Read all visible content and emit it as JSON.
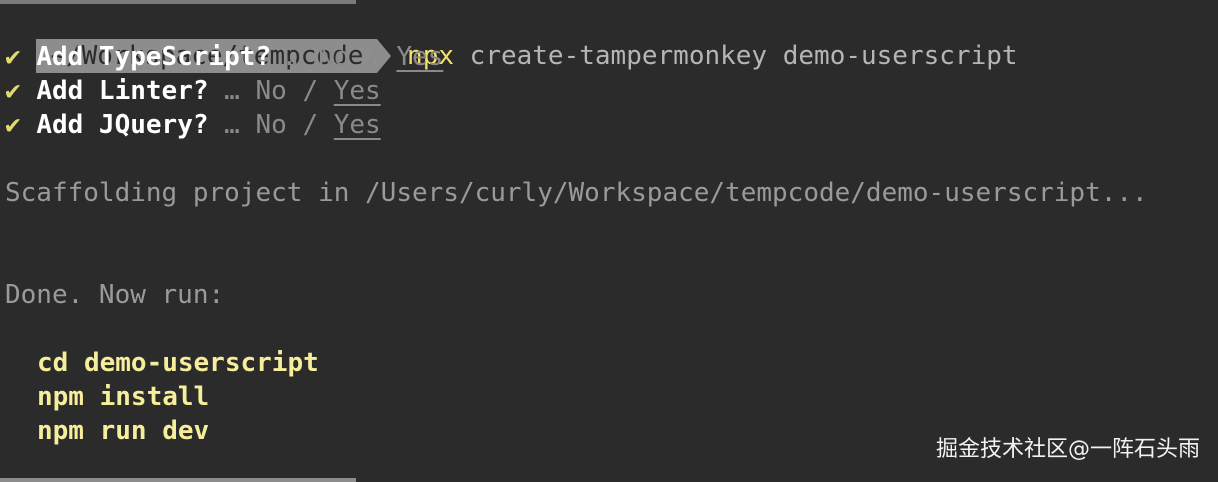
{
  "prompt": {
    "path": "~/Workspace/tempcode",
    "command": "npx",
    "args": " create-tampermonkey demo-userscript"
  },
  "questions": [
    {
      "check": "✔",
      "label": "Add TypeScript?",
      "ellipsis": "…",
      "no": "No",
      "slash": "/",
      "yes": "Yes"
    },
    {
      "check": "✔",
      "label": "Add Linter?",
      "ellipsis": "…",
      "no": "No",
      "slash": "/",
      "yes": "Yes"
    },
    {
      "check": "✔",
      "label": "Add JQuery?",
      "ellipsis": "…",
      "no": "No",
      "slash": "/",
      "yes": "Yes"
    }
  ],
  "scaffolding": "Scaffolding project in /Users/curly/Workspace/tempcode/demo-userscript...",
  "done": "Done. Now run:",
  "commands": [
    "cd demo-userscript",
    "npm install",
    "npm run dev"
  ],
  "watermark": "掘金技术社区@一阵石头雨"
}
